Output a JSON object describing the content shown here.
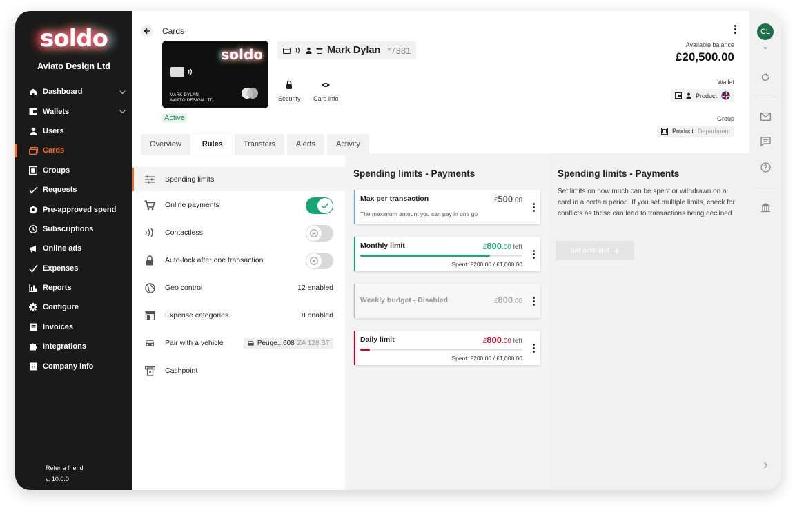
{
  "brand": {
    "logo_text": "soldo",
    "company": "Aviato Design Ltd"
  },
  "sidebar": {
    "items": [
      {
        "label": "Dashboard",
        "icon": "home-icon",
        "expandable": true
      },
      {
        "label": "Wallets",
        "icon": "wallet-icon",
        "expandable": true
      },
      {
        "label": "Users",
        "icon": "user-icon"
      },
      {
        "label": "Cards",
        "icon": "cards-icon",
        "active": true
      },
      {
        "label": "Groups",
        "icon": "groups-icon"
      },
      {
        "label": "Requests",
        "icon": "requests-icon"
      },
      {
        "label": "Pre-approved spend",
        "icon": "pre-approved-icon"
      },
      {
        "label": "Subscriptions",
        "icon": "subscriptions-icon"
      },
      {
        "label": "Online ads",
        "icon": "megaphone-icon"
      },
      {
        "label": "Expenses",
        "icon": "expenses-icon"
      },
      {
        "label": "Reports",
        "icon": "reports-icon"
      },
      {
        "label": "Configure",
        "icon": "gear-icon"
      },
      {
        "label": "Invoices",
        "icon": "invoice-icon"
      },
      {
        "label": "Integrations",
        "icon": "puzzle-icon"
      },
      {
        "label": "Company info",
        "icon": "building-icon"
      }
    ],
    "refer": "Refer a friend",
    "version": "v. 10.0.0"
  },
  "header": {
    "breadcrumb": "Cards",
    "card": {
      "logo_text": "soldo",
      "holder_line1": "MARK DYLAN",
      "holder_line2": "AVIATO DESIGN LTD",
      "status": "Active"
    },
    "holder": {
      "name": "Mark Dylan",
      "last_digits": "*7381"
    },
    "actions": [
      {
        "label": "Security",
        "icon": "lock-icon"
      },
      {
        "label": "Card info",
        "icon": "eye-icon"
      }
    ],
    "balance_label": "Available balance",
    "balance": "£20,500.00",
    "wallet_label": "Wallet",
    "wallet_value": "Product",
    "group_label": "Group",
    "group_value": "Product",
    "group_type": "Department"
  },
  "tabs": [
    "Overview",
    "Rules",
    "Transfers",
    "Alerts",
    "Activity"
  ],
  "active_tab": "Rules",
  "rules": [
    {
      "label": "Spending limits",
      "icon": "sliders-icon",
      "active": true
    },
    {
      "label": "Online payments",
      "icon": "cart-icon",
      "toggle": true
    },
    {
      "label": "Contactless",
      "icon": "contactless-icon",
      "toggle": false
    },
    {
      "label": "Auto-lock after one transaction",
      "icon": "lock-icon",
      "toggle": false
    },
    {
      "label": "Geo control",
      "icon": "globe-icon",
      "value": "12 enabled"
    },
    {
      "label": "Expense categories",
      "icon": "store-icon",
      "value": "8 enabled"
    },
    {
      "label": "Pair with a vehicle",
      "icon": "car-icon",
      "vehicle": "Peuge...608",
      "plate": "ZA 128 BT"
    },
    {
      "label": "Cashpoint",
      "icon": "atm-icon"
    }
  ],
  "limits": {
    "title": "Spending limits - Payments",
    "cards": [
      {
        "name": "Max per transaction",
        "currency": "£",
        "amount": "500",
        "decimals": ".00",
        "suffix": "",
        "desc": "The maximum amount you can pay in one go",
        "accent": "#6fa8dc"
      },
      {
        "name": "Monthly limit",
        "currency": "£",
        "amount": "800",
        "decimals": ".00",
        "suffix": " left",
        "spent": "Spent: £200.00 / £1,000.00",
        "progress": 0.8,
        "accent": "#1aa672",
        "amount_color": "#1aa672"
      },
      {
        "name": "Weekly budget - Disabled",
        "currency": "£",
        "amount": "800",
        "decimals": ".00",
        "suffix": "",
        "accent": "#bbbbbb",
        "disabled": true
      },
      {
        "name": "Daily limit",
        "currency": "£",
        "amount": "800",
        "decimals": ".00",
        "suffix": " left",
        "spent": "Spent: £200.00 / £1,000.00",
        "progress": 0.06,
        "accent": "#d0021b",
        "amount_color": "#c0112b"
      }
    ]
  },
  "help": {
    "title": "Spending limits - Payments",
    "text": "Set limits on how much can be spent or withdrawn on a card in a certain period. If you set multiple limits, check for conflicts as these can lead to transactions being declined.",
    "button": "Set new limit"
  },
  "rail": {
    "avatar": "CL"
  },
  "colors": {
    "accent": "#ff6a1f",
    "success": "#1aa672",
    "danger": "#d0021b",
    "sidebar_bg": "#1a1a1a"
  }
}
